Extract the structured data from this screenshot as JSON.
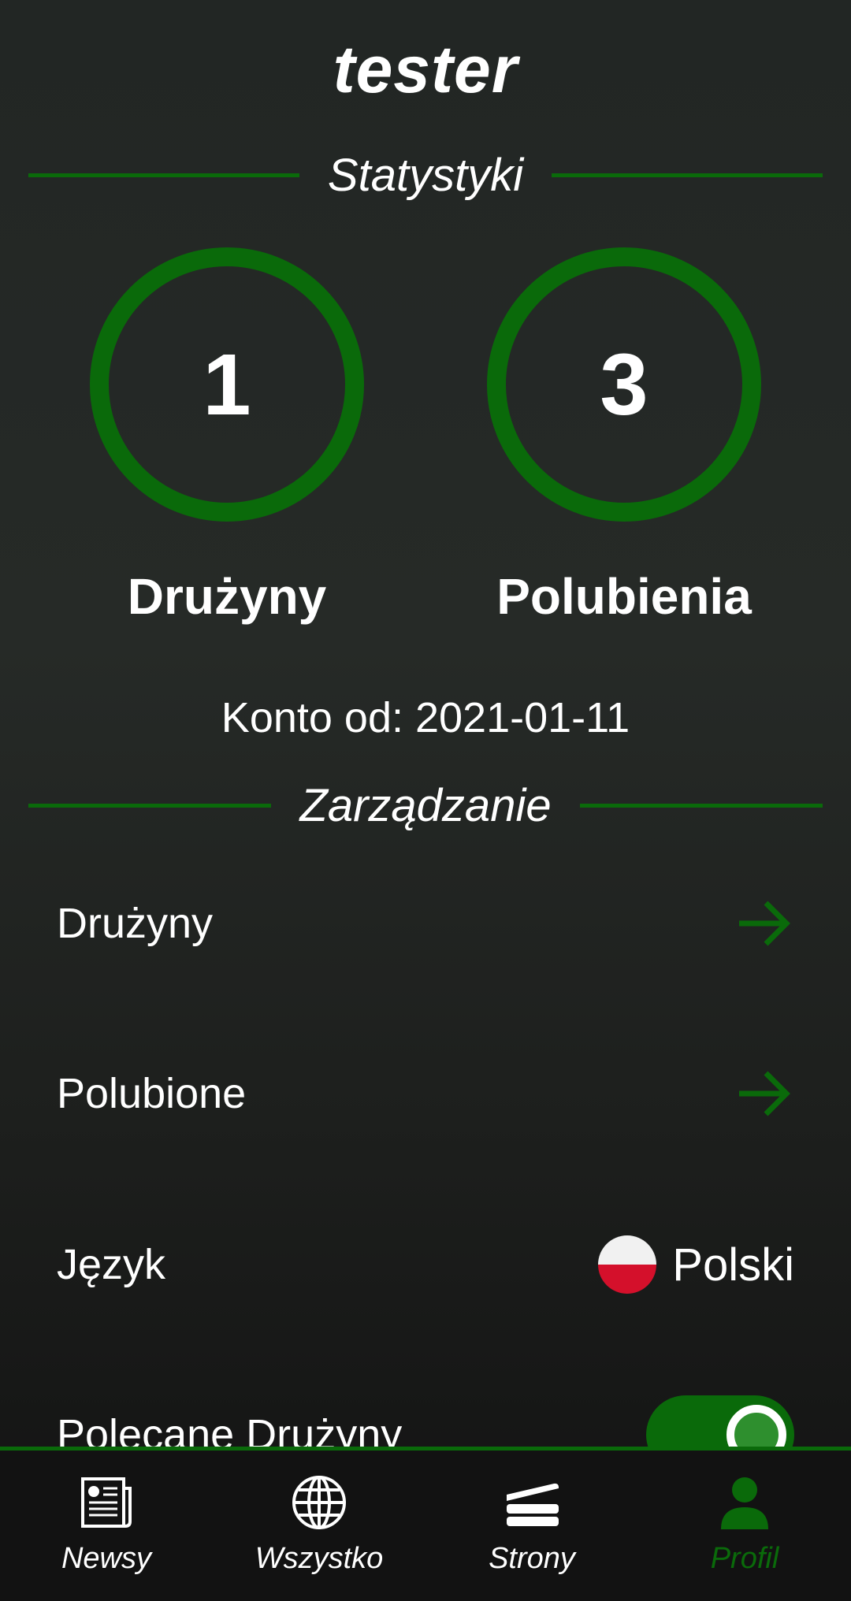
{
  "profile": {
    "username": "tester",
    "stats_title": "Statystyki",
    "stats": [
      {
        "value": "1",
        "label": "Drużyny"
      },
      {
        "value": "3",
        "label": "Polubienia"
      }
    ],
    "account_since": "Konto od: 2021-01-11",
    "manage_title": "Zarządzanie"
  },
  "menu": {
    "teams": "Drużyny",
    "liked": "Polubione",
    "language_label": "Język",
    "language_value": "Polski",
    "recommended": "Polecane Drużyny",
    "recommended_enabled": true
  },
  "nav": {
    "items": [
      {
        "label": "Newsy",
        "icon": "newspaper-icon"
      },
      {
        "label": "Wszystko",
        "icon": "globe-icon"
      },
      {
        "label": "Strony",
        "icon": "pages-icon"
      },
      {
        "label": "Profil",
        "icon": "person-icon"
      }
    ],
    "active": "Profil"
  },
  "colors": {
    "accent": "#0a6a0a",
    "background": "#242826",
    "nav_background": "#121212"
  }
}
